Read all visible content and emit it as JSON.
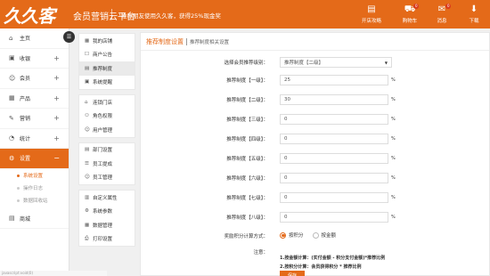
{
  "header": {
    "logo_text": "久久客",
    "brand": "会员营销云平台",
    "notice": "推荐朋友使用久久客，获得25%现金奖",
    "actions": [
      {
        "icon": "▤",
        "label": "开店攻略"
      },
      {
        "icon": "⛟",
        "label": "购物车",
        "badge": "0"
      },
      {
        "icon": "✉",
        "label": "消息",
        "badge": "0"
      },
      {
        "icon": "⬇",
        "label": "下载"
      }
    ],
    "accent_color": "#e46a19"
  },
  "sidebar": {
    "items": [
      {
        "icon": "⌂",
        "label": "主页",
        "plus": ""
      },
      {
        "icon": "▣",
        "label": "收银",
        "plus": "+"
      },
      {
        "icon": "☺",
        "label": "会员",
        "plus": "+"
      },
      {
        "icon": "▦",
        "label": "产品",
        "plus": "+"
      },
      {
        "icon": "✎",
        "label": "营销",
        "plus": "+"
      },
      {
        "icon": "◔",
        "label": "统计",
        "plus": "+"
      },
      {
        "icon": "⚙",
        "label": "设置",
        "plus": "−"
      }
    ],
    "sub_items": [
      "系统设置",
      "操作日志",
      "数据回收站"
    ],
    "last_item": {
      "icon": "▤",
      "label": "商城"
    }
  },
  "subnav": {
    "groups": [
      [
        "我的店铺",
        "商户公告",
        "推荐制度",
        "系统提醒"
      ],
      [
        "连锁门店",
        "角色权限",
        "用户管理"
      ],
      [
        "部门设置",
        "员工提成",
        "员工管理"
      ],
      [
        "自定义属性",
        "系统参数",
        "数据管理",
        "打印设置"
      ]
    ],
    "icons": [
      [
        "▦",
        "☐",
        "▤",
        "▣"
      ],
      [
        "⌂",
        "⚇",
        "☺"
      ],
      [
        "▤",
        "☰",
        "☺"
      ],
      [
        "▥",
        "⚙",
        "▦",
        "⎙"
      ]
    ]
  },
  "page": {
    "title": "推荐制度设置",
    "subtitle": "推荐制度相关设置",
    "select_label": "选择会员推荐级别：",
    "select_value": "推荐制度【二级】",
    "rows": [
      {
        "label": "推荐制度【一级】：",
        "value": "25",
        "unit": "%"
      },
      {
        "label": "推荐制度【二级】：",
        "value": "30",
        "unit": "%"
      },
      {
        "label": "推荐制度【三级】：",
        "value": "0",
        "unit": "%"
      },
      {
        "label": "推荐制度【四级】：",
        "value": "0",
        "unit": "%"
      },
      {
        "label": "推荐制度【五级】：",
        "value": "0",
        "unit": "%"
      },
      {
        "label": "推荐制度【六级】：",
        "value": "0",
        "unit": "%"
      },
      {
        "label": "推荐制度【七级】：",
        "value": "0",
        "unit": "%"
      },
      {
        "label": "推荐制度【八级】：",
        "value": "0",
        "unit": "%"
      }
    ],
    "reward_label": "奖励积分计算方式：",
    "reward_options": [
      {
        "label": "按积分",
        "checked": true
      },
      {
        "label": "按金额",
        "checked": false
      }
    ],
    "note_label": "注意：",
    "notes": [
      "1.按金额计算：(实付金额 - 积分支付金额)*推荐比例",
      "2.按积分计算：会员获得积分 * 推荐比例"
    ],
    "save_label": "保存"
  },
  "status_bar": "javascript:void(0)"
}
